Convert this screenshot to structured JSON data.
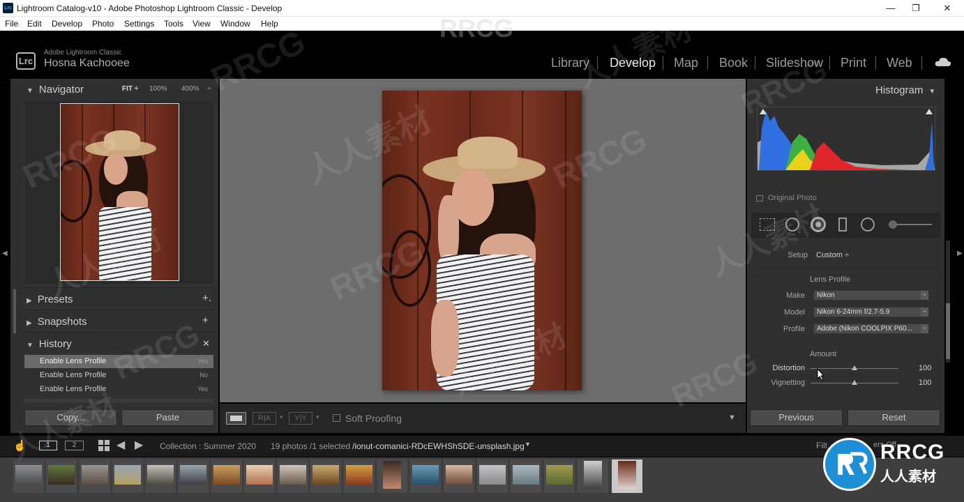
{
  "window": {
    "app_icon": "Lrc",
    "title": "Lightroom Catalog-v10 - Adobe Photoshop Lightroom Classic - Develop",
    "controls": {
      "minimize": "—",
      "maximize": "❐",
      "close": "✕"
    }
  },
  "menu": [
    "File",
    "Edit",
    "Develop",
    "Photo",
    "Settings",
    "Tools",
    "View",
    "Window",
    "Help"
  ],
  "identity": {
    "logo": "Lrc",
    "brand": "Adobe Lightroom Classic",
    "user": "Hosna Kachooee"
  },
  "modules": [
    "Library",
    "Develop",
    "Map",
    "Book",
    "Slideshow",
    "Print",
    "Web"
  ],
  "active_module": "Develop",
  "left": {
    "navigator": {
      "title": "Navigator",
      "fit": "FIT ÷",
      "zoom1": "100%",
      "zoom2": "400%",
      "more": "÷"
    },
    "presets": {
      "title": "Presets",
      "action": "+."
    },
    "snapshots": {
      "title": "Snapshots",
      "action": "+"
    },
    "history": {
      "title": "History",
      "action": "✕",
      "items": [
        {
          "label": "Enable Lens Profile",
          "value": "Yes"
        },
        {
          "label": "Enable Lens Profile",
          "value": "No"
        },
        {
          "label": "Enable Lens Profile",
          "value": "Yes"
        }
      ]
    },
    "copy_btn": "Copy...",
    "paste_btn": "Paste"
  },
  "toolbar": {
    "soft_proofing": "Soft Proofing",
    "before_after_1": "R|A",
    "before_after_2": "Y|Y"
  },
  "right": {
    "histogram_title": "Histogram",
    "original_photo": "Original Photo",
    "histogram_colors": {
      "blue": "#2f6fe0",
      "green": "#3cb043",
      "yellow": "#e8d21b",
      "red": "#e0262a",
      "gray": "#a7a7a7"
    },
    "setup_label": "Setup",
    "setup_value": "Custom ÷",
    "lens_profile_header": "Lens Profile",
    "make_label": "Make",
    "make_value": "Nikon",
    "model_label": "Model",
    "model_value": "Nikon 6-24mm f/2.7-5.9",
    "profile_label": "Profile",
    "profile_value": "Adobe (Nikon COOLPIX P60...",
    "amount_header": "Amount",
    "distortion_label": "Distortion",
    "distortion_value": "100",
    "vignetting_label": "Vignetting",
    "vignetting_value": "100",
    "previous_btn": "Previous",
    "reset_btn": "Reset"
  },
  "filmbar": {
    "view1": "1",
    "view2": "2",
    "collection": "Collection : Summer 2020",
    "count": "19 photos /1 selected",
    "filename": "/ionut-comanici-RDcEWHShSDE-unsplash.jpg",
    "filter": "Filt",
    "filter_value": "ers Off"
  },
  "watermark": {
    "logo_text": "RRCG",
    "sub_text": "人人素材",
    "overlay": "RRCG",
    "overlay_cn": "人人素材"
  }
}
